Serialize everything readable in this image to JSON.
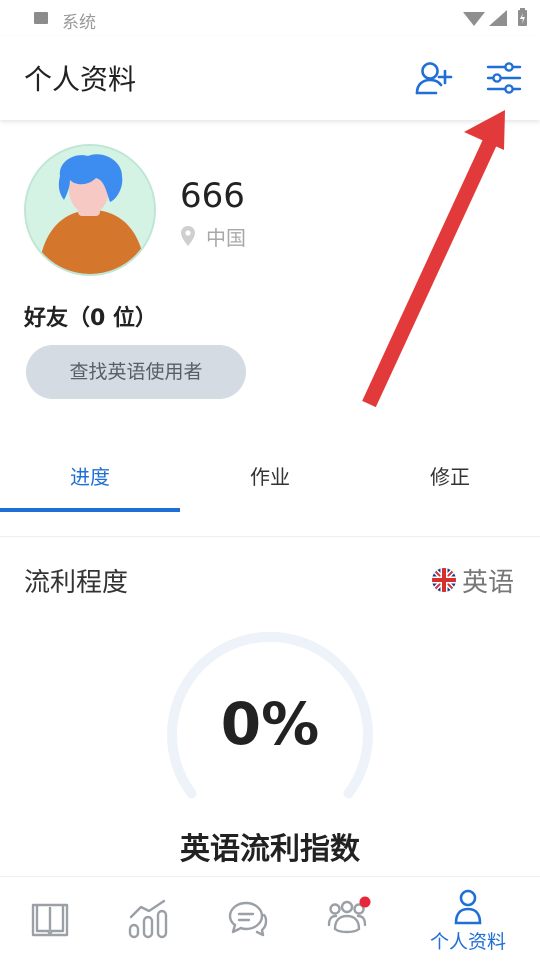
{
  "status_bar": {
    "title": "系统"
  },
  "header": {
    "title": "个人资料"
  },
  "profile": {
    "username": "666",
    "location": "中国",
    "friends_label": "好友（0 位）",
    "find_button_label": "查找英语使用者"
  },
  "tabs": [
    {
      "label": "进度",
      "active": true
    },
    {
      "label": "作业",
      "active": false
    },
    {
      "label": "修正",
      "active": false
    }
  ],
  "fluency": {
    "title": "流利程度",
    "language": "英语",
    "percent": "0%",
    "index_label": "英语流利指数",
    "progress_fraction": 0
  },
  "bottom_nav": {
    "items": [
      {
        "icon": "book-icon"
      },
      {
        "icon": "progress-chart-icon"
      },
      {
        "icon": "chat-icon"
      },
      {
        "icon": "community-icon",
        "badge": true
      },
      {
        "icon": "profile-icon",
        "label": "个人资料",
        "active": true
      }
    ]
  },
  "colors": {
    "accent": "#1f6fd6",
    "annotation_arrow": "#e23a3a",
    "badge": "#e8283a"
  }
}
